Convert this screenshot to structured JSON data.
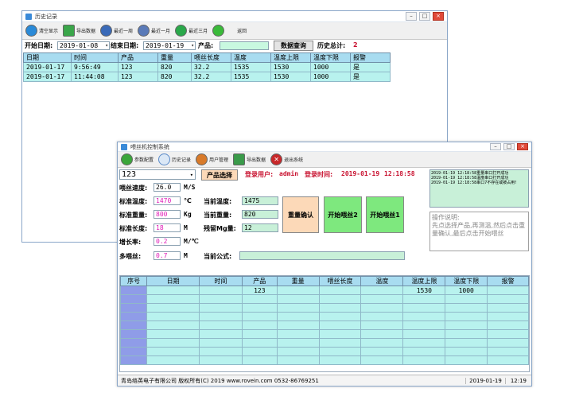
{
  "hist_window": {
    "title": "历史记录",
    "toolbar": [
      {
        "label": "清空显示",
        "icon": "clear-icon",
        "color": "#2a8ad8"
      },
      {
        "label": "导出数据",
        "icon": "export-icon",
        "color": "#3aa64a"
      },
      {
        "label": "最近一周",
        "icon": "week-icon",
        "color": "#3a6ab8"
      },
      {
        "label": "最近一月",
        "icon": "month-icon",
        "color": "#5a7ab8"
      },
      {
        "label": "最近三月",
        "icon": "clock-icon",
        "color": "#2aa84a"
      },
      {
        "label": "返回",
        "icon": "back-icon",
        "color": "#3aba3a"
      }
    ],
    "filter": {
      "start_label": "开始日期:",
      "start_value": "2019-01-08",
      "end_label": "结束日期:",
      "end_value": "2019-01-19",
      "product_label": "产品:",
      "product_value": "",
      "query_button": "数据查询",
      "total_label": "历史总计:",
      "total_value": "2"
    },
    "columns": [
      "日期",
      "时间",
      "产品",
      "重量",
      "喂丝长度",
      "温度",
      "温度上限",
      "温度下限",
      "报警"
    ],
    "rows": [
      [
        "2019-01-17",
        "9:56:49",
        "123",
        "820",
        "32.2",
        "1535",
        "1530",
        "1000",
        "是"
      ],
      [
        "2019-01-17",
        "11:44:08",
        "123",
        "820",
        "32.2",
        "1535",
        "1530",
        "1000",
        "是"
      ]
    ]
  },
  "main_window": {
    "title": "喂丝机控制系统",
    "toolbar": [
      {
        "label": "参数配置",
        "icon": "gear-icon",
        "color": "#3aa63a"
      },
      {
        "label": "历史记录",
        "icon": "search-icon",
        "color": "#5a8ac8"
      },
      {
        "label": "用户管理",
        "icon": "user-icon",
        "color": "#d87a2a"
      },
      {
        "label": "导出数据",
        "icon": "export-icon",
        "color": "#3a9a4a"
      },
      {
        "label": "退出系统",
        "icon": "exit-icon",
        "color": "#c8282a"
      }
    ],
    "product_select": "123",
    "product_button": "产品选择",
    "login": {
      "user_label": "登录用户:",
      "user": "admin",
      "time_label": "登录时间:",
      "date": "2019-01-19",
      "time": "12:18:58"
    },
    "log": [
      "2019-01-19 12:18:58重量串口打开成功",
      "2019-01-19 12:18:58温度串口打开成功",
      "2019-01-19 12:18:58串口7不存在或被占用!"
    ],
    "help": {
      "title": "操作说明:",
      "text": "先点选择产品,再测温,然后点击重量确认,最后点击开始喂丝"
    },
    "params": {
      "speed": {
        "label": "喂丝速度:",
        "value": "26.0",
        "unit": "M/S"
      },
      "temp": {
        "label": "标准温度:",
        "value": "1470",
        "unit": "℃"
      },
      "weight": {
        "label": "标准重量:",
        "value": "800",
        "unit": "Kg"
      },
      "length": {
        "label": "标准长度:",
        "value": "18",
        "unit": "M"
      },
      "growth": {
        "label": "增长率:",
        "value": "0.2",
        "unit": "M/℃"
      },
      "multi": {
        "label": "多喂丝:",
        "value": "0.7",
        "unit": "M"
      }
    },
    "current": {
      "temp_label": "当前温度:",
      "temp_value": "1475",
      "weight_label": "当前重量:",
      "weight_value": "820",
      "residual_label": "残留Mg量:",
      "residual_value": "12",
      "formula_label": "当前公式:",
      "formula_value": ""
    },
    "buttons": {
      "confirm_weight": "重量确认",
      "start_feed_2": "开始喂丝2",
      "start_feed_1": "开始喂丝1"
    },
    "columns": [
      "序号",
      "日期",
      "时间",
      "产品",
      "重量",
      "喂丝长度",
      "温度",
      "温度上限",
      "温度下限",
      "报警"
    ],
    "rows": [
      [
        "",
        "",
        "",
        "123",
        "",
        "",
        "",
        "1530",
        "1000",
        ""
      ],
      [
        "",
        "",
        "",
        "",
        "",
        "",
        "",
        "",
        "",
        ""
      ],
      [
        "",
        "",
        "",
        "",
        "",
        "",
        "",
        "",
        "",
        ""
      ],
      [
        "",
        "",
        "",
        "",
        "",
        "",
        "",
        "",
        "",
        ""
      ],
      [
        "",
        "",
        "",
        "",
        "",
        "",
        "",
        "",
        "",
        ""
      ],
      [
        "",
        "",
        "",
        "",
        "",
        "",
        "",
        "",
        "",
        ""
      ],
      [
        "",
        "",
        "",
        "",
        "",
        "",
        "",
        "",
        "",
        ""
      ],
      [
        "",
        "",
        "",
        "",
        "",
        "",
        "",
        "",
        "",
        ""
      ],
      [
        "",
        "",
        "",
        "",
        "",
        "",
        "",
        "",
        "",
        ""
      ]
    ],
    "status": {
      "company": "青岛络英电子有限公司 版权所有(C) 2019 www.rovein.com 0532-86769251",
      "date": "2019-01-19",
      "time": "12:19"
    },
    "colors": {
      "magenta": "#e01ab8",
      "title_red": "#c8102e",
      "cyan": "#b8f2ee",
      "green_btn": "#7ee87e",
      "orange_btn": "#fcd9b8"
    }
  }
}
